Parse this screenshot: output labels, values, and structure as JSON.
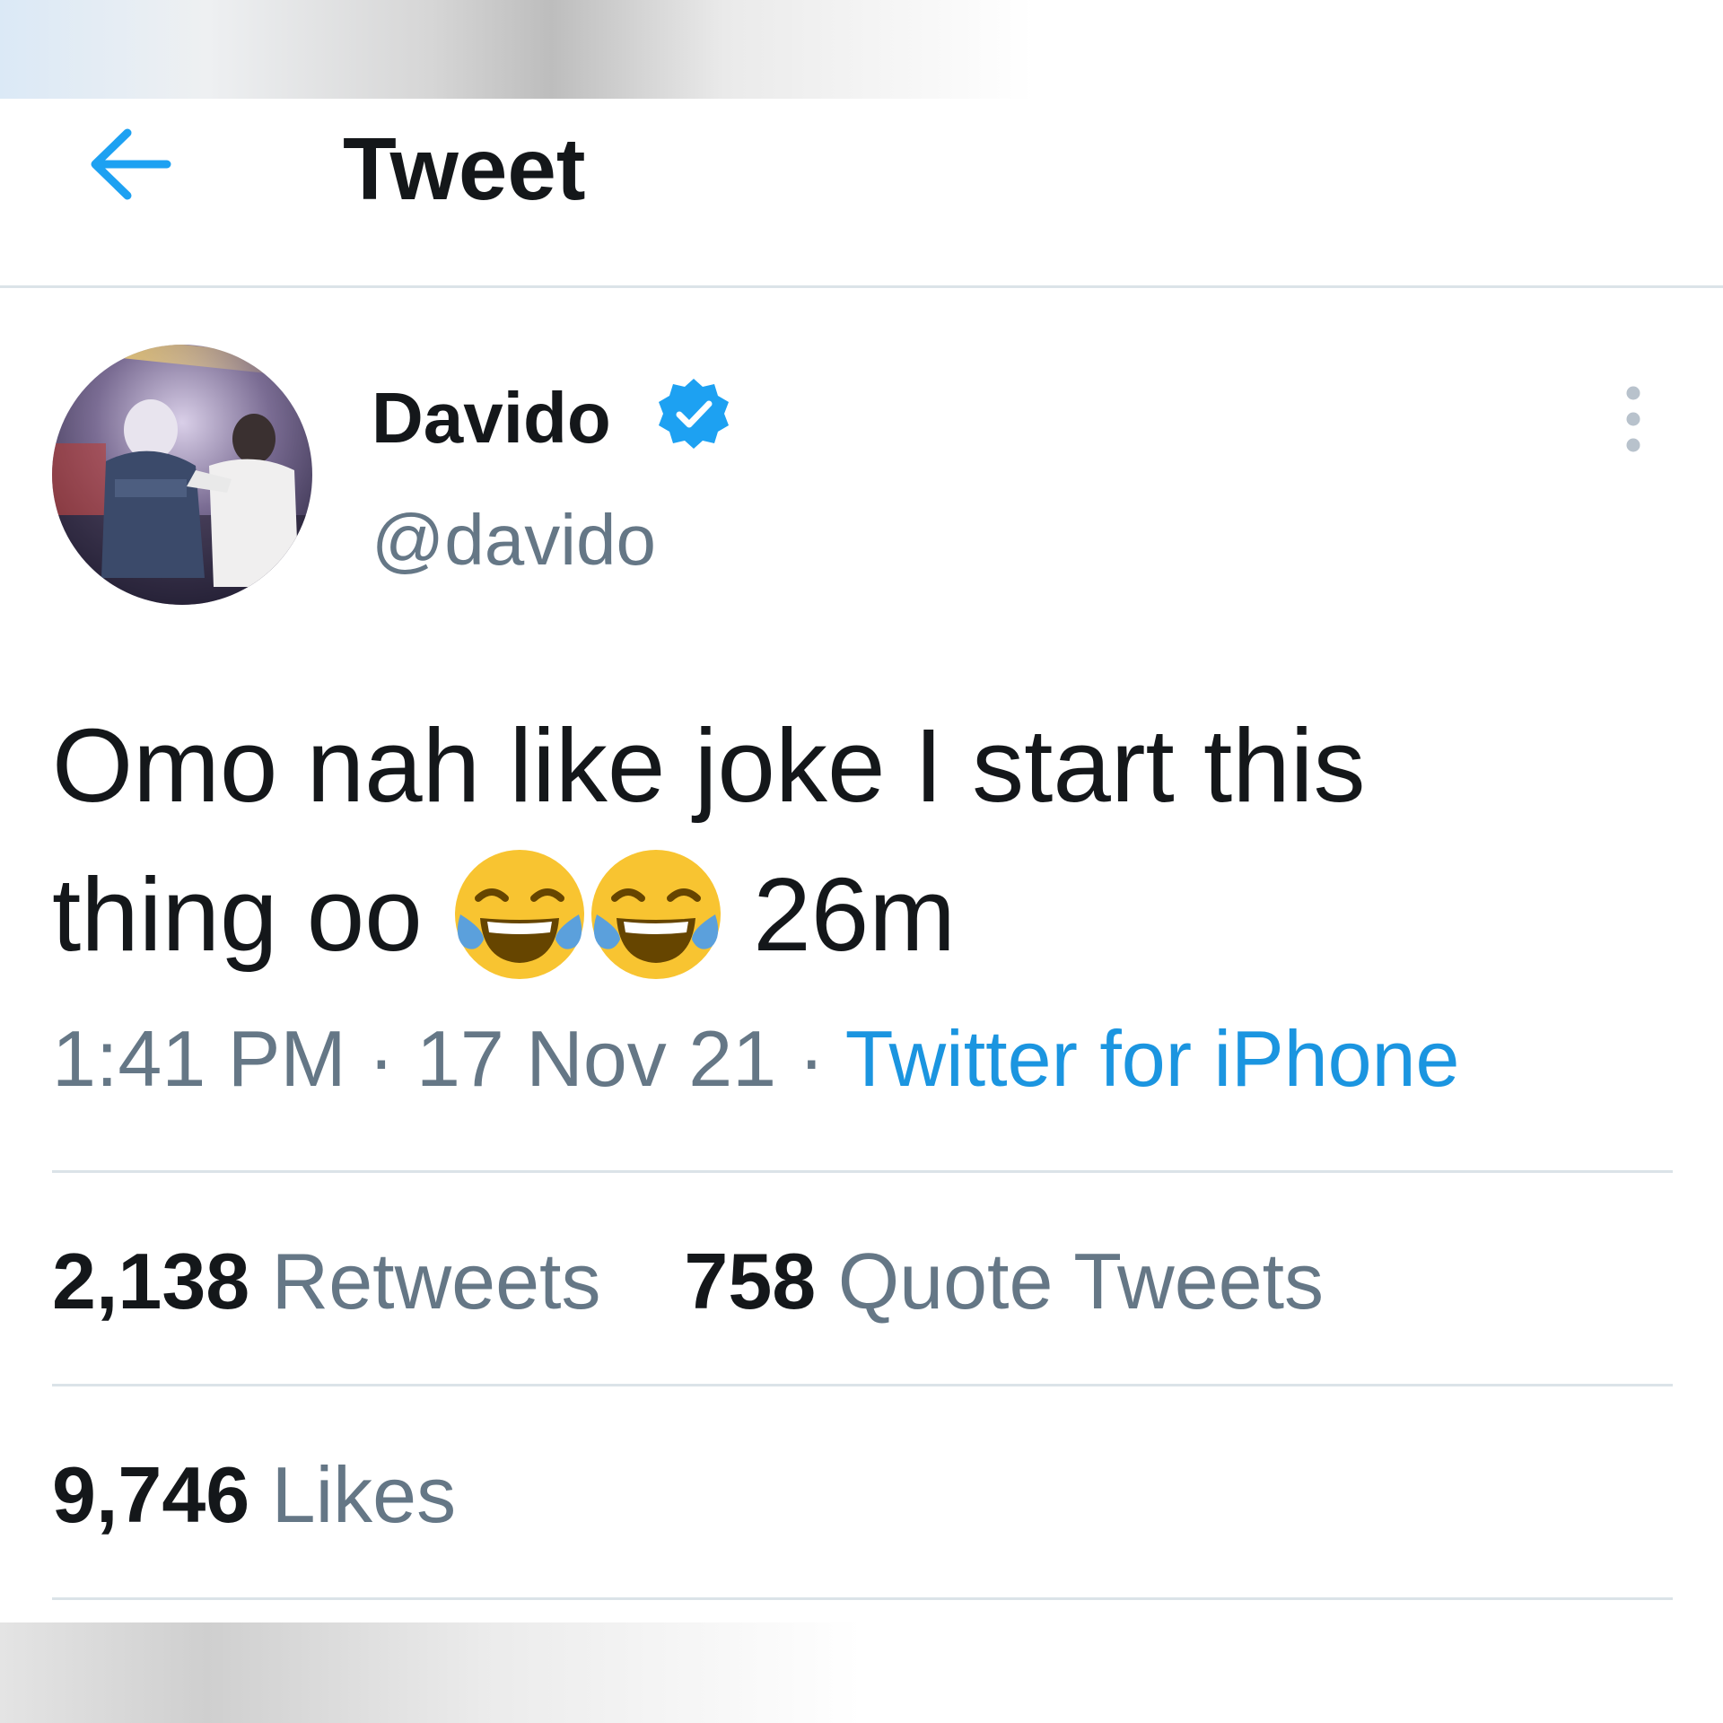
{
  "header": {
    "title": "Tweet",
    "back_icon": "arrow-left-icon"
  },
  "tweet": {
    "author": {
      "display_name": "Davido",
      "handle": "@davido",
      "verified": true
    },
    "text_line1": "Omo nah like joke I start this",
    "text_line2_start": "thing oo",
    "text_line2_end": "26m",
    "emoji": "face-with-tears-of-joy",
    "time": "1:41 PM",
    "separator": "·",
    "date": "17 Nov 21",
    "source": "Twitter for iPhone"
  },
  "stats": {
    "retweets_count": "2,138",
    "retweets_label": "Retweets",
    "quotes_count": "758",
    "quotes_label": "Quote Tweets",
    "likes_count": "9,746",
    "likes_label": "Likes"
  },
  "colors": {
    "accent": "#1da1f2",
    "link": "#1b95e0",
    "secondary_text": "#657786",
    "primary_text": "#14171a",
    "divider": "#dbe3e8",
    "emoji_face": "#f8c431",
    "emoji_tear": "#5ba0dc"
  }
}
